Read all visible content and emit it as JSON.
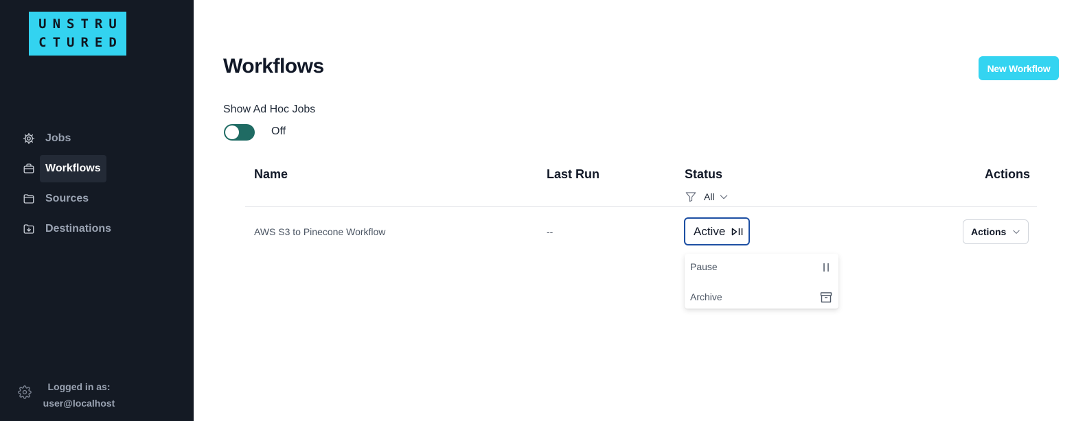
{
  "app": {
    "logo_line1": "UNSTRU",
    "logo_line2": "CTURED",
    "brand_color": "#33d3f0"
  },
  "sidebar": {
    "items": [
      {
        "label": "Jobs",
        "icon": "gear-icon",
        "active": false
      },
      {
        "label": "Workflows",
        "icon": "briefcase-icon",
        "active": true
      },
      {
        "label": "Sources",
        "icon": "folder-icon",
        "active": false
      },
      {
        "label": "Destinations",
        "icon": "folder-download-icon",
        "active": false
      }
    ],
    "logged_in_label": "Logged in as:",
    "user": "user@localhost"
  },
  "main": {
    "title": "Workflows",
    "new_button": "New Workflow",
    "adhoc_label": "Show Ad Hoc Jobs",
    "adhoc_state": "Off",
    "table": {
      "headers": {
        "name": "Name",
        "last_run": "Last Run",
        "status": "Status",
        "actions": "Actions"
      },
      "status_filter": "All",
      "rows": [
        {
          "name": "AWS S3 to Pinecone Workflow",
          "last_run": "--",
          "status": "Active",
          "actions": "Actions"
        }
      ]
    },
    "status_menu": {
      "items": [
        {
          "label": "Pause",
          "icon": "pause-icon"
        },
        {
          "label": "Archive",
          "icon": "archive-icon"
        }
      ]
    }
  }
}
